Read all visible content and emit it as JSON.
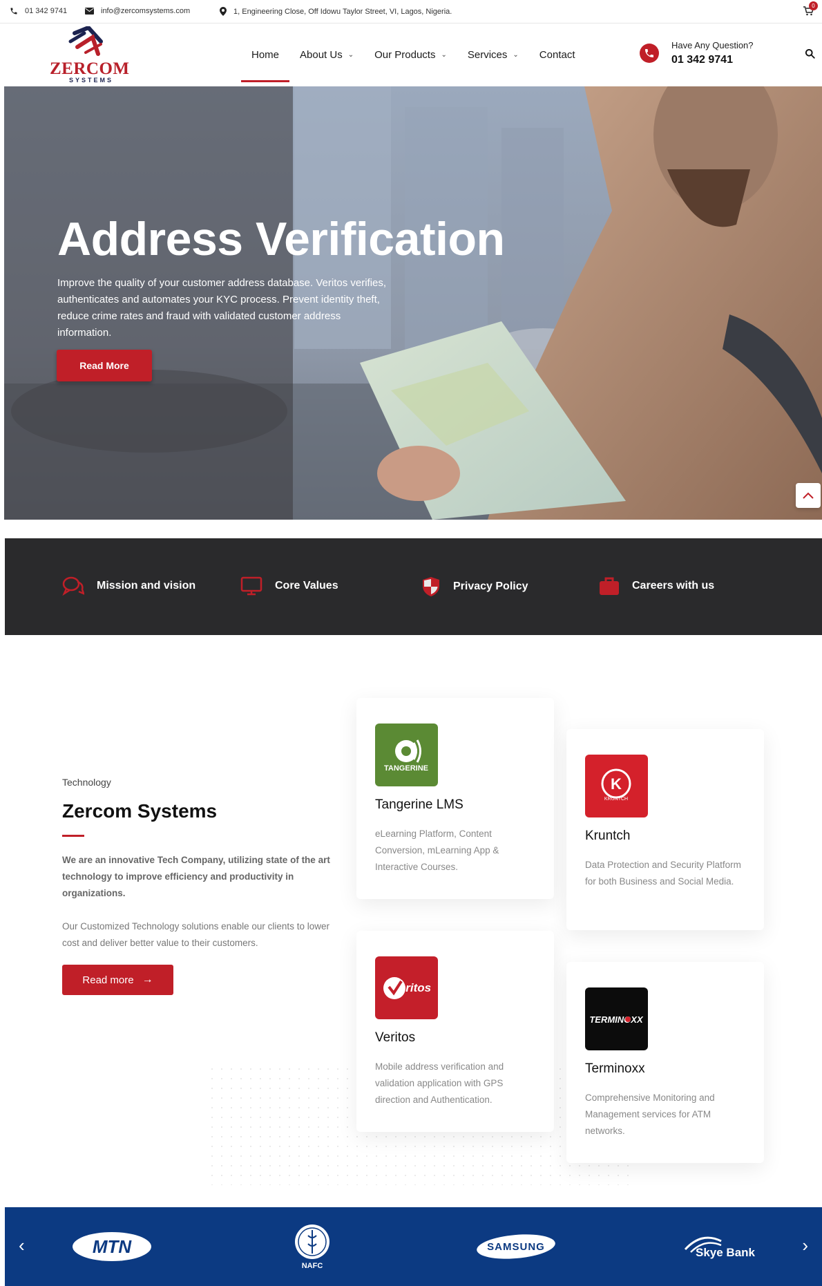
{
  "topbar": {
    "phone": "01 342 9741",
    "email": "info@zercomsystems.com",
    "address": "1, Engineering Close, Off Idowu Taylor Street, VI, Lagos, Nigeria.",
    "cart_count": "0"
  },
  "header": {
    "logo_text": "ZERCOM",
    "logo_sub": "SYSTEMS",
    "nav": [
      {
        "label": "Home"
      },
      {
        "label": "About Us"
      },
      {
        "label": "Our Products"
      },
      {
        "label": "Services"
      },
      {
        "label": "Contact"
      }
    ],
    "contact_question": "Have Any Question?",
    "contact_number": "01 342 9741"
  },
  "hero": {
    "title": "Address Verification",
    "text": "Improve the quality of your customer address database. Veritos verifies, authenticates and automates your KYC process. Prevent identity theft, reduce crime rates and fraud with validated customer address information.",
    "button": "Read More"
  },
  "features": [
    {
      "label": "Mission and vision",
      "icon": "chat-icon"
    },
    {
      "label": "Core Values",
      "icon": "monitor-icon"
    },
    {
      "label": "Privacy Policy",
      "icon": "shield-icon"
    },
    {
      "label": "Careers with us",
      "icon": "briefcase-icon"
    }
  ],
  "about": {
    "tag": "Technology",
    "title": "Zercom Systems",
    "bold_text": "We are an innovative Tech Company, utilizing state of the art technology to improve efficiency and productivity in organizations.",
    "text": "Our Customized Technology solutions enable our clients to lower cost and deliver better value to their customers.",
    "button": "Read more"
  },
  "products": [
    {
      "name": "Tangerine LMS",
      "logo_text": "TANGERINE",
      "desc": "eLearning Platform, Content Conversion, mLearning App & Interactive Courses.",
      "color": "#5b8a34"
    },
    {
      "name": "Kruntch",
      "logo_text": "KRUNTCH",
      "desc": "Data Protection and Security Platform for both Business and Social Media.",
      "color": "#d4212b"
    },
    {
      "name": "Veritos",
      "logo_text": "eritos",
      "desc": "Mobile address verification and validation application with GPS direction and Authentication.",
      "color": "#c41f2a"
    },
    {
      "name": "Terminoxx",
      "logo_text": "TERMINOXX",
      "desc": "Comprehensive Monitoring and Management services for ATM networks.",
      "color": "#0c0c0c"
    }
  ],
  "partners": [
    {
      "name": "MTN"
    },
    {
      "name": "NAFC"
    },
    {
      "name": "SAMSUNG"
    },
    {
      "name": "Skye Bank"
    }
  ],
  "colors": {
    "brand_red": "#c01f28",
    "dark_band": "#2a2a2c",
    "partner_blue": "#0c3a82"
  }
}
